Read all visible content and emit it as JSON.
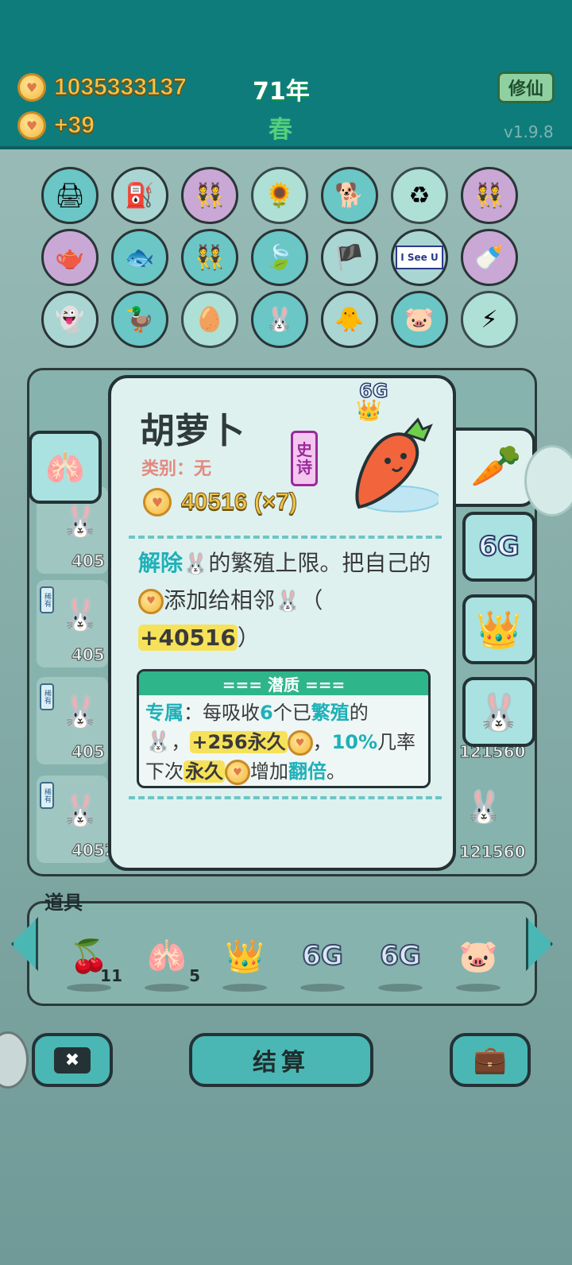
{
  "header": {
    "money": "1035333137",
    "income": "+39",
    "year": "71年",
    "season": "春",
    "mode_button": "修仙",
    "version": "v1.9.8"
  },
  "grid_icons": [
    {
      "name": "printer-warning-icon",
      "glyph": "🖨"
    },
    {
      "name": "pump-icon",
      "glyph": "⛽"
    },
    {
      "name": "twins-icon",
      "glyph": "👯"
    },
    {
      "name": "sunflowers-icon",
      "glyph": "🌻"
    },
    {
      "name": "dog-icon",
      "glyph": "🐕"
    },
    {
      "name": "recycle-icon",
      "glyph": "♻"
    },
    {
      "name": "twins-icon",
      "glyph": "👯"
    },
    {
      "name": "gravy-boat-icon",
      "glyph": "🫖"
    },
    {
      "name": "fishbowl-icon",
      "glyph": "🐟"
    },
    {
      "name": "twins-icon",
      "glyph": "👯"
    },
    {
      "name": "leaf-icon",
      "glyph": "🍃"
    },
    {
      "name": "eyepatch-icon",
      "glyph": "🏴"
    },
    {
      "name": "i-see-u-icon",
      "glyph": "I See U"
    },
    {
      "name": "breast-pump-icon",
      "glyph": "🍼"
    },
    {
      "name": "ghost-icon",
      "glyph": "👻"
    },
    {
      "name": "pot-duck-icon",
      "glyph": "🦆"
    },
    {
      "name": "egg-icon",
      "glyph": "🥚"
    },
    {
      "name": "bunny-icon",
      "glyph": "🐰"
    },
    {
      "name": "chick-icon",
      "glyph": "🐥"
    },
    {
      "name": "piggy-bank-icon",
      "glyph": "🐷"
    },
    {
      "name": "lightning-icon",
      "glyph": "⚡"
    }
  ],
  "board": {
    "rarity_tag": "稀有",
    "left_values": [
      "405",
      "405",
      "405",
      "4052"
    ],
    "right_values": [
      "121560",
      "121560"
    ]
  },
  "card": {
    "title": "胡萝卜",
    "category": "类别：无",
    "rarity": [
      "史",
      "诗"
    ],
    "value": "40516 (×7)",
    "badge_6g": "6G",
    "desc": {
      "kw1": "解除",
      "t1": "的繁殖上限。把自己的",
      "t2": "添加给相邻",
      "t3": "（",
      "bonus": "+40516",
      "t4": "）"
    },
    "potential": {
      "header": "=== 潜质 ===",
      "kw_exclusive": "专属",
      "t1": "：每吸收",
      "n6": "6",
      "t2": "个已",
      "kw_breed": "繁殖",
      "t3": "的",
      "t4": "，",
      "perm_bonus": "+256永久",
      "t5": "，",
      "chance": "10%",
      "t6": "几率下次",
      "perm": "永久",
      "t7": "增加",
      "double": "翻倍",
      "t8": "。"
    }
  },
  "right_tabs": {
    "tab_6g": "6G"
  },
  "items": {
    "label": "道具",
    "list": [
      {
        "name": "lychee-icon",
        "glyph": "🍒",
        "count": "11"
      },
      {
        "name": "liver-icon",
        "glyph": "🫁",
        "count": "5"
      },
      {
        "name": "crown-icon",
        "glyph": "👑",
        "count": ""
      },
      {
        "name": "6g-icon",
        "glyph": "6G",
        "count": ""
      },
      {
        "name": "6g-icon",
        "glyph": "6G",
        "count": ""
      },
      {
        "name": "piggy-bank-icon",
        "glyph": "🐷",
        "count": ""
      }
    ]
  },
  "bottom": {
    "cancel_glyph": "✖",
    "settle_label": "结算",
    "bag_glyph": "💼"
  },
  "colors": {
    "header_bg": "#0f7c7c",
    "card_bg": "#dff1ef",
    "accent_teal": "#1fb0b8",
    "highlight_yellow": "#f6e25a",
    "epic_purple": "#9a2a9a"
  }
}
